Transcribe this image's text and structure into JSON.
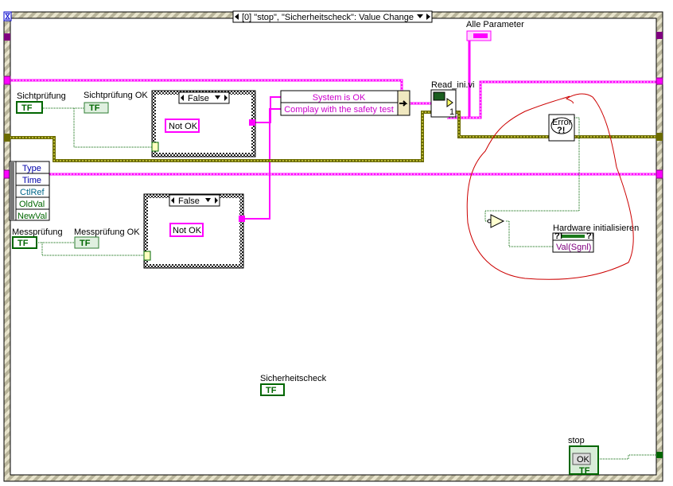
{
  "event_structure": {
    "case_selector": "[0] \"stop\", \"Sicherheitscheck\": Value Change",
    "event_data_fields": [
      "Type",
      "Time",
      "CtlRef",
      "OldVal",
      "NewVal"
    ]
  },
  "controls": {
    "sichtpruefung": {
      "label": "Sichtprüfung",
      "glyph": "TF"
    },
    "sichtpruefung_ok": {
      "label": "Sichtprüfung OK",
      "glyph": "TF"
    },
    "messpruefung": {
      "label": "Messprüfung",
      "glyph": "TF"
    },
    "messpruefung_ok": {
      "label": "Messprüfung OK",
      "glyph": "TF"
    },
    "sicherheitscheck": {
      "label": "Sicherheitscheck",
      "glyph": "TF"
    },
    "stop": {
      "label": "stop",
      "button": "OK",
      "glyph": "TF"
    },
    "alle_parameter": {
      "label": "Alle Parameter"
    }
  },
  "case_structures": [
    {
      "selector": "False",
      "constant": "Not OK"
    },
    {
      "selector": "False",
      "constant": "Not OK"
    }
  ],
  "bundle": {
    "items": [
      "System is OK",
      "Complay with the safety test"
    ]
  },
  "subvi": {
    "label": "Read_ini.vi",
    "index": "1"
  },
  "error_node": {
    "text": "Error",
    "glyph": "?!"
  },
  "property_node": {
    "label": "Hardware initialisieren",
    "property": "Val(Sgnl)"
  },
  "colors": {
    "string_wire": "#ff00ff",
    "error_wire": "#7f7f00",
    "boolean_wire": "#006600",
    "annotation": "#cc0000"
  }
}
